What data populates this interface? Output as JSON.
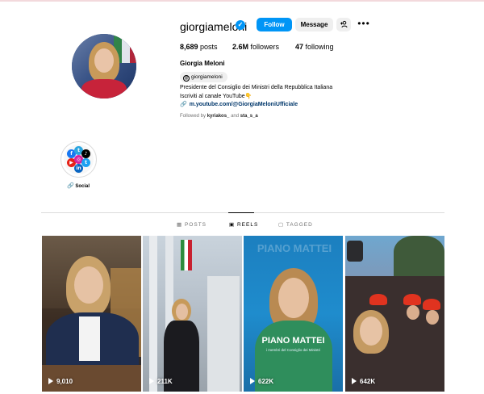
{
  "profile": {
    "username": "giorgiameloni",
    "follow_label": "Follow",
    "message_label": "Message",
    "add_user_glyph": "+♟",
    "more_glyph": "•••",
    "posts_count": "8,689",
    "posts_label": "posts",
    "followers_count": "2.6M",
    "followers_label": "followers",
    "following_count": "47",
    "following_label": "following",
    "full_name": "Giorgia Meloni",
    "threads_handle": "giorgiameloni",
    "bio_line1": "Presidente del Consiglio dei Ministri della Repubblica Italiana",
    "bio_line2": "Iscriviti al canale YouTube👇",
    "link_text": "m.youtube.com/@GiorgiaMeloniUfficiale",
    "followed_by_prefix": "Followed by",
    "followed_by_user1": "kyriakos_",
    "followed_by_and": "and",
    "followed_by_user2": "sta_s_a",
    "accent_color": "#0095f6"
  },
  "highlight": {
    "label": "Social",
    "icons": [
      "facebook-icon",
      "tiktok-icon",
      "youtube-icon",
      "threads-icon",
      "linkedin-icon",
      "twitter-icon",
      "instagram-icon"
    ]
  },
  "tabs": [
    {
      "label": "POSTS",
      "icon": "grid-icon"
    },
    {
      "label": "REELS",
      "icon": "reels-icon"
    },
    {
      "label": "TAGGED",
      "icon": "tagged-icon"
    }
  ],
  "reels": [
    {
      "views": "9,010"
    },
    {
      "views": "211K"
    },
    {
      "views": "622K",
      "overlay_title": "PIANO MATTEI",
      "overlay_subtitle": "i membri del Consiglio dei Ministri",
      "overlay_watermark": "PIANO MATTEI"
    },
    {
      "views": "642K"
    }
  ]
}
